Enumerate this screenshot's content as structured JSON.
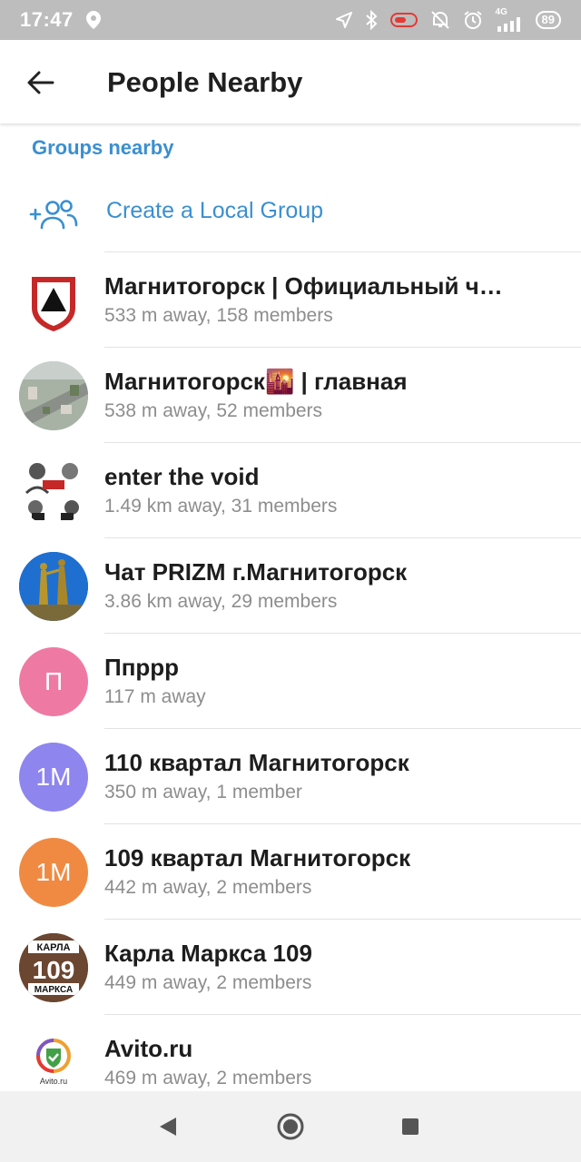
{
  "status_bar": {
    "time": "17:47",
    "network": "4G",
    "battery": "89"
  },
  "app_bar": {
    "title": "People Nearby"
  },
  "section": {
    "header": "Groups nearby",
    "create_label": "Create a Local Group"
  },
  "groups": [
    {
      "name": "Магнитогорск | Официальный ч…",
      "meta": "533 m away, 158 members",
      "avatar": "coat-of-arms-image"
    },
    {
      "name": "Магнитогорск🌇 | главная",
      "meta": "538 m away, 52 members",
      "avatar": "city-photo-image"
    },
    {
      "name": "enter the void",
      "meta": "1.49 km away, 31 members",
      "avatar": "sketch-image"
    },
    {
      "name": "Чат PRIZM г.Магнитогорск",
      "meta": "3.86 km away, 29 members",
      "avatar": "monument-photo-image"
    },
    {
      "name": "Ппррр",
      "meta": "117 m away",
      "avatar_initials": "П",
      "avatar_color": "#ee7aa3"
    },
    {
      "name": "110 квартал Магнитогорск",
      "meta": "350 m away, 1 member",
      "avatar_initials": "1М",
      "avatar_color": "#8e85ee"
    },
    {
      "name": "109 квартал Магнитогорск",
      "meta": "442 m away, 2 members",
      "avatar_initials": "1М",
      "avatar_color": "#f08a43"
    },
    {
      "name": "Карла Маркса 109",
      "meta": "449 m away, 2 members",
      "avatar": "karla-marksa-109-image",
      "avatar_text": [
        "КАРЛА",
        "109",
        "МАРКСА"
      ]
    },
    {
      "name": "Avito.ru",
      "meta": "469 m away, 2 members",
      "avatar": "avito-logo-image",
      "avatar_text": [
        "Avito.ru"
      ]
    }
  ],
  "colors": {
    "accent": "#3a8fd0",
    "status_bar": "#bdbdbd"
  }
}
